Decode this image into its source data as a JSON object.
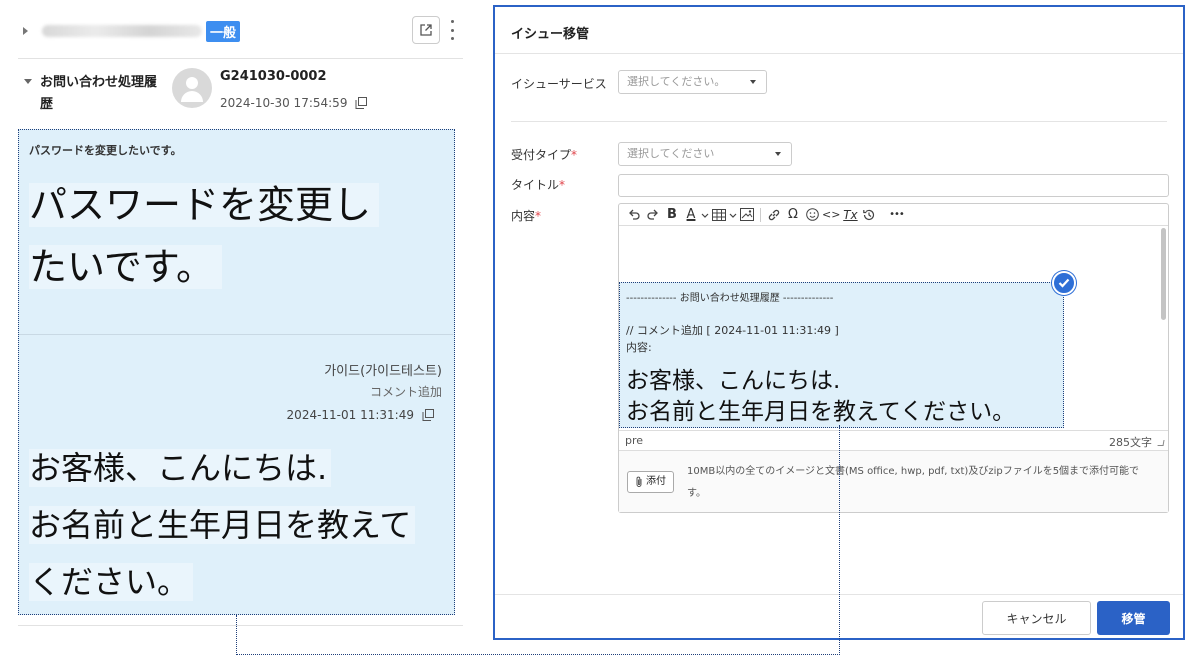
{
  "left_panel": {
    "category_badge": "一般",
    "history": {
      "label": "お問い合わせ処理履歴",
      "ticket_id": "G241030-0002",
      "created_at": "2024-10-30 17:54:59"
    },
    "zoom": {
      "small_title": "パスワードを変更したいです。",
      "big_line1": "パスワードを変更し",
      "big_line2": "たいです。",
      "author": "가이드(가이드테스트)",
      "action": "コメント追加",
      "comment_date": "2024-11-01 11:31:49",
      "body_line1": "お客様、こんにちは.",
      "body_line2": "お名前と生年月日を教えて",
      "body_line3": "ください。"
    }
  },
  "modal": {
    "title": "イシュー移管",
    "issue_service": {
      "label": "イシューサービス",
      "placeholder": "選択してください。"
    },
    "reception_type": {
      "label": "受付タイプ",
      "required_mark": "*",
      "placeholder": "選択してください"
    },
    "title_field": {
      "label": "タイトル",
      "required_mark": "*",
      "value": ""
    },
    "content": {
      "label": "内容",
      "required_mark": "*",
      "toolbar": [
        "undo-icon",
        "redo-icon",
        "bold-icon",
        "text-color-icon",
        "table-icon",
        "image-icon",
        "link-icon",
        "special-char-icon",
        "emoji-icon",
        "code-icon",
        "clear-format-icon",
        "history-icon",
        "more-icon"
      ],
      "bold_glyph": "B",
      "font_color_glyph": "A",
      "omega_glyph": "Ω",
      "code_glyph": "<>",
      "clear_glyph": "Tx",
      "more_glyph": "•••",
      "zoom": {
        "heading": "-------------- お問い合わせ処理履歴 --------------",
        "comment_line": "// コメント追加 [ 2024-11-01 11:31:49 ]",
        "content_label": "内容:",
        "big_line1": "お客様、こんにちは.",
        "big_line2": "お名前と生年月日を教えてください。"
      },
      "status_tag": "pre",
      "char_count": "285文字"
    },
    "attachment": {
      "button_label": "添付",
      "note": "10MB以内の全てのイメージと文書(MS office, hwp, pdf, txt)及びzipファイルを5個まで添付可能です。"
    },
    "buttons": {
      "cancel": "キャンセル",
      "move": "移管"
    },
    "colors": {
      "primary": "#2b62c6",
      "required": "#e0454c",
      "zoom_bg": "#dff0fa",
      "badge": "#3d8ef0"
    }
  }
}
